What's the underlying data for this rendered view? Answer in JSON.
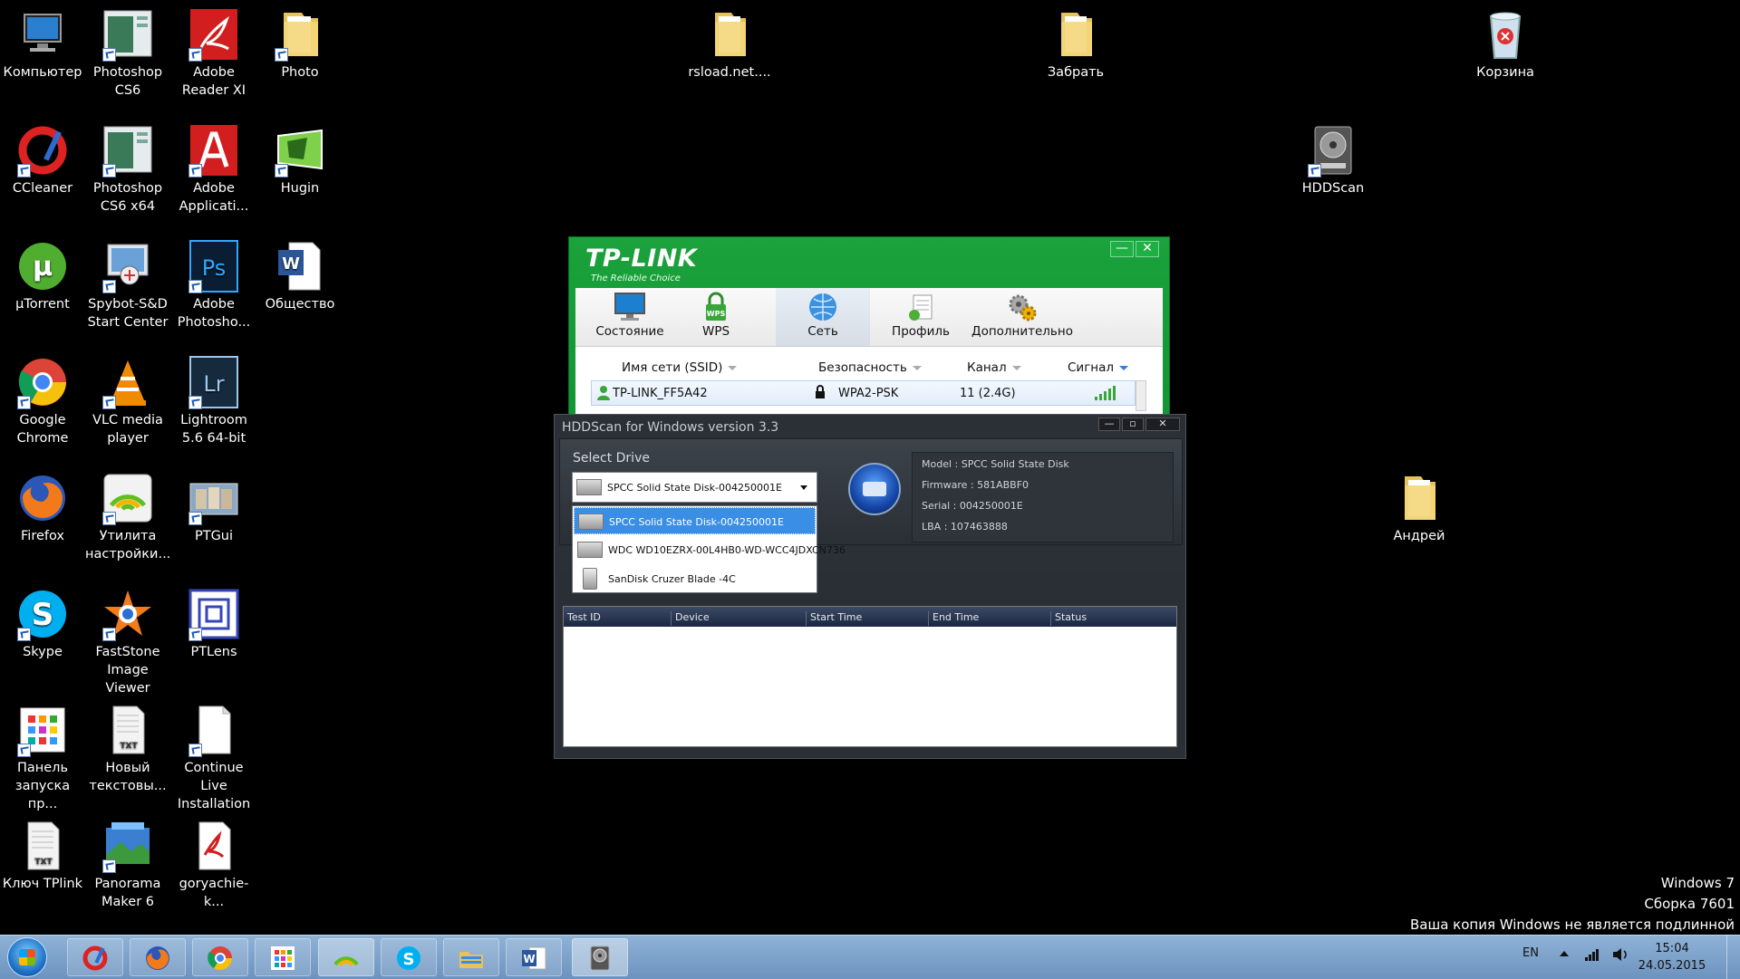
{
  "desktop": {
    "icons": [
      {
        "label": "Компьютер",
        "icon": "computer-icon"
      },
      {
        "label": "Photoshop CS6",
        "icon": "photoshop-cs6-icon"
      },
      {
        "label": "Adobe Reader XI",
        "icon": "adobe-reader-icon"
      },
      {
        "label": "Photo",
        "icon": "folder-icon"
      },
      {
        "label": "CCleaner",
        "icon": "ccleaner-icon"
      },
      {
        "label": "Photoshop CS6 x64",
        "icon": "photoshop-cs6-x64-icon"
      },
      {
        "label": "Adobe Applicati...",
        "icon": "adobe-application-icon"
      },
      {
        "label": "Hugin",
        "icon": "hugin-icon"
      },
      {
        "label": "µTorrent",
        "icon": "utorrent-icon"
      },
      {
        "label": "Spybot-S&D Start Center",
        "icon": "spybot-icon"
      },
      {
        "label": "Adobe Photosho...",
        "icon": "photoshop-icon"
      },
      {
        "label": "Общество",
        "icon": "word-doc-icon"
      },
      {
        "label": "Google Chrome",
        "icon": "chrome-icon"
      },
      {
        "label": "VLC media player",
        "icon": "vlc-icon"
      },
      {
        "label": "Lightroom 5.6 64-bit",
        "icon": "lightroom-icon"
      },
      {
        "label": "Firefox",
        "icon": "firefox-icon"
      },
      {
        "label": "Утилита настройки...",
        "icon": "tplink-utility-icon"
      },
      {
        "label": "PTGui",
        "icon": "ptgui-icon"
      },
      {
        "label": "Skype",
        "icon": "skype-icon"
      },
      {
        "label": "FastStone Image Viewer",
        "icon": "faststone-icon"
      },
      {
        "label": "PTLens",
        "icon": "ptlens-icon"
      },
      {
        "label": "Панель запуска пр...",
        "icon": "launch-panel-icon"
      },
      {
        "label": "Новый текстовы...",
        "icon": "text-file-icon"
      },
      {
        "label": "Continue Live Installation",
        "icon": "blank-file-icon"
      },
      {
        "label": "Ключ TPlink",
        "icon": "text-file-icon"
      },
      {
        "label": "Panorama Maker 6",
        "icon": "panorama-maker-icon"
      },
      {
        "label": "goryachie-k...",
        "icon": "pdf-file-icon"
      },
      {
        "label": "rsload.net....",
        "icon": "folder-icon"
      },
      {
        "label": "Забрать",
        "icon": "folder-icon"
      },
      {
        "label": "Корзина",
        "icon": "recycle-bin-icon"
      },
      {
        "label": "HDDScan",
        "icon": "hddscan-icon"
      },
      {
        "label": "Андрей",
        "icon": "folder-icon"
      }
    ]
  },
  "tplink": {
    "brand": "TP-LINK",
    "tagline": "The Reliable Choice",
    "minimize": "—",
    "close": "✕",
    "tabs": [
      {
        "label": "Состояние",
        "icon": "monitor-icon"
      },
      {
        "label": "WPS",
        "icon": "wps-lock-icon"
      },
      {
        "label": "Сеть",
        "icon": "globe-icon"
      },
      {
        "label": "Профиль",
        "icon": "profile-icon"
      },
      {
        "label": "Дополнительно",
        "icon": "gears-icon"
      }
    ],
    "columns": {
      "ssid": "Имя сети (SSID)",
      "security": "Безопасность",
      "channel": "Канал",
      "signal": "Сигнал"
    },
    "network": {
      "ssid": "TP-LINK_FF5A42",
      "security": "WPA2-PSK",
      "channel": "11 (2.4G)"
    }
  },
  "hddscan": {
    "title": "HDDScan for Windows version 3.3",
    "select_drive": "Select Drive",
    "selected": "SPCC Solid State Disk-004250001E",
    "drives": [
      "SPCC Solid State Disk-004250001E",
      "WDC WD10EZRX-00L4HB0-WD-WCC4JDXCN736",
      "SanDisk Cruzer Blade    -4C"
    ],
    "info": {
      "model": "Model : SPCC Solid State Disk",
      "firmware": "Firmware : 581ABBF0",
      "serial": "Serial : 004250001E",
      "lba": "LBA : 107463888"
    },
    "columns": [
      "Test ID",
      "Device",
      "Start Time",
      "End Time",
      "Status"
    ]
  },
  "watermark": {
    "line1": "Windows 7",
    "line2": "Сборка 7601",
    "line3": "Ваша копия Windows не является подлинной"
  },
  "taskbar": {
    "lang": "EN",
    "time": "15:04",
    "date": "24.05.2015",
    "apps": [
      "ccleaner-icon",
      "firefox-icon",
      "chrome-icon",
      "launch-panel-icon",
      "tplink-utility-icon",
      "skype-icon",
      "explorer-icon",
      "word-icon",
      "hddscan-icon"
    ]
  }
}
